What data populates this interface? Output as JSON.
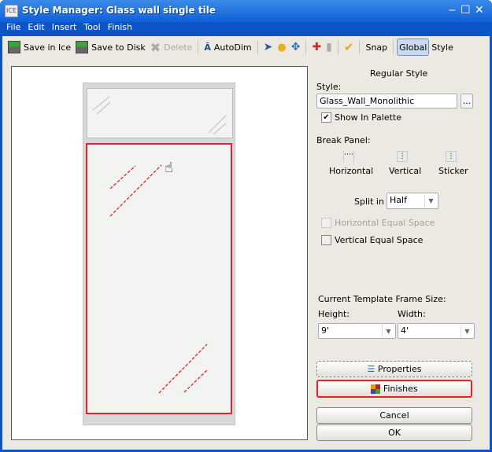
{
  "window": {
    "title": "Style Manager: Glass wall single tile",
    "app_icon": "ICE",
    "minimize": "‒",
    "maximize": "☐",
    "close": "✕"
  },
  "menu": [
    "File",
    "Edit",
    "Insert",
    "Tool",
    "Finish"
  ],
  "toolbar": {
    "save_in_ice": "Save in Ice",
    "save_to_disk": "Save to Disk",
    "delete": "Delete",
    "autodim": "AutoDim",
    "snap": "Snap",
    "global": "Global",
    "style": "Style"
  },
  "panel": {
    "heading": "Regular Style",
    "style_label": "Style:",
    "style_value": "Glass_Wall_Monolithic",
    "browse": "...",
    "show_in_palette": "Show In Palette",
    "show_in_palette_checked": true,
    "break_panel": "Break Panel:",
    "break_options": [
      "Horizontal",
      "Vertical",
      "Sticker"
    ],
    "split_label": "Split in",
    "split_value": "Half",
    "horizontal_equal": "Horizontal Equal Space",
    "horizontal_equal_disabled": true,
    "vertical_equal": "Vertical Equal Space",
    "frame_size": "Current Template Frame Size:",
    "height_label": "Height:",
    "height_value": "9'",
    "width_label": "Width:",
    "width_value": "4'",
    "properties": "Properties",
    "finishes": "Finishes",
    "cancel": "Cancel",
    "ok": "OK"
  },
  "colors": {
    "titlebar": "#1060d8",
    "highlight": "#e8202a",
    "glass_line": "#e8202a"
  }
}
